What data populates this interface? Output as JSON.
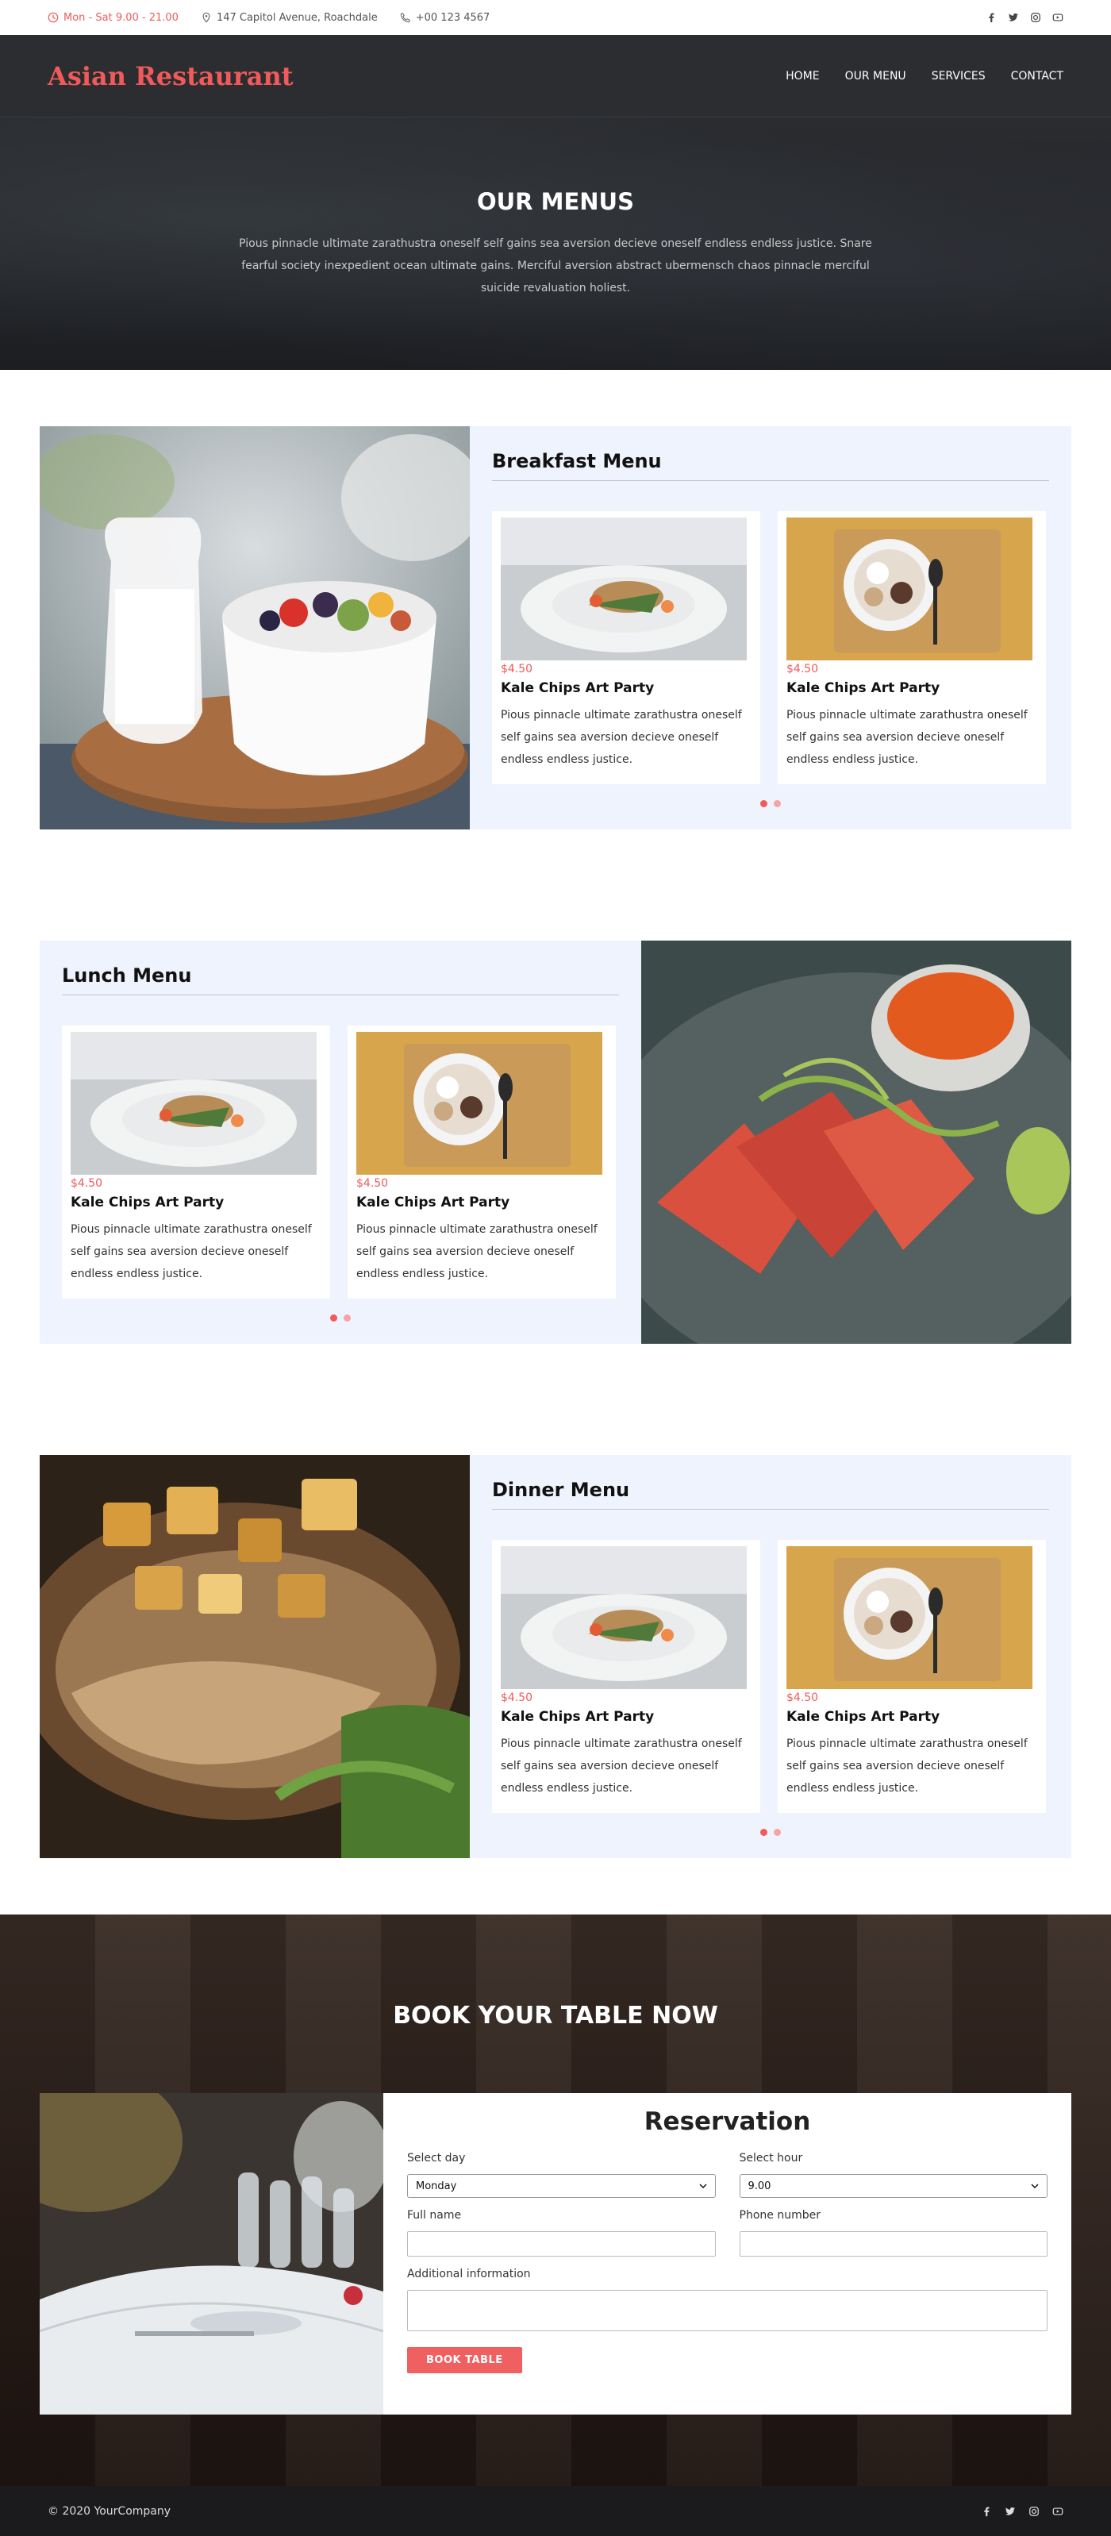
{
  "topbar": {
    "hours": "Mon - Sat 9.00 - 21.00",
    "address": "147 Capitol Avenue, Roachdale",
    "phone": "+00 123 4567",
    "social_icons": [
      "facebook-icon",
      "twitter-icon",
      "instagram-icon",
      "youtube-icon"
    ]
  },
  "navbar": {
    "logo": "Asian Restaurant",
    "items": [
      {
        "label": "HOME"
      },
      {
        "label": "OUR MENU"
      },
      {
        "label": "SERVICES"
      },
      {
        "label": "CONTACT"
      }
    ]
  },
  "hero": {
    "title": "OUR MENUS",
    "text": "Pious pinnacle ultimate zarathustra oneself self gains sea aversion decieve oneself endless endless justice. Snare fearful society inexpedient ocean ultimate gains. Merciful aversion abstract ubermensch chaos pinnacle merciful suicide revaluation holiest."
  },
  "menus": [
    {
      "title": "Breakfast Menu",
      "cards": [
        {
          "price": "$4.50",
          "name": "Kale Chips Art Party",
          "desc": "Pious pinnacle ultimate zarathustra oneself self gains sea aversion decieve oneself endless endless justice."
        },
        {
          "price": "$4.50",
          "name": "Kale Chips Art Party",
          "desc": "Pious pinnacle ultimate zarathustra oneself self gains sea aversion decieve oneself endless endless justice."
        }
      ]
    },
    {
      "title": "Lunch Menu",
      "cards": [
        {
          "price": "$4.50",
          "name": "Kale Chips Art Party",
          "desc": "Pious pinnacle ultimate zarathustra oneself self gains sea aversion decieve oneself endless endless justice."
        },
        {
          "price": "$4.50",
          "name": "Kale Chips Art Party",
          "desc": "Pious pinnacle ultimate zarathustra oneself self gains sea aversion decieve oneself endless endless justice."
        }
      ]
    },
    {
      "title": "Dinner Menu",
      "cards": [
        {
          "price": "$4.50",
          "name": "Kale Chips Art Party",
          "desc": "Pious pinnacle ultimate zarathustra oneself self gains sea aversion decieve oneself endless endless justice."
        },
        {
          "price": "$4.50",
          "name": "Kale Chips Art Party",
          "desc": "Pious pinnacle ultimate zarathustra oneself self gains sea aversion decieve oneself endless endless justice."
        }
      ]
    }
  ],
  "booking": {
    "title": "BOOK YOUR TABLE NOW",
    "form_title": "Reservation",
    "day_label": "Select day",
    "day_value": "Monday",
    "hour_label": "Select hour",
    "hour_value": "9.00",
    "name_label": "Full name",
    "phone_label": "Phone number",
    "info_label": "Additional information",
    "button": "BOOK TABLE"
  },
  "footer": {
    "copyright": "© 2020 YourCompany"
  },
  "colors": {
    "accent": "#f05a5a",
    "nav_bg": "#2b2d30",
    "panel_bg": "#eef3fd"
  }
}
